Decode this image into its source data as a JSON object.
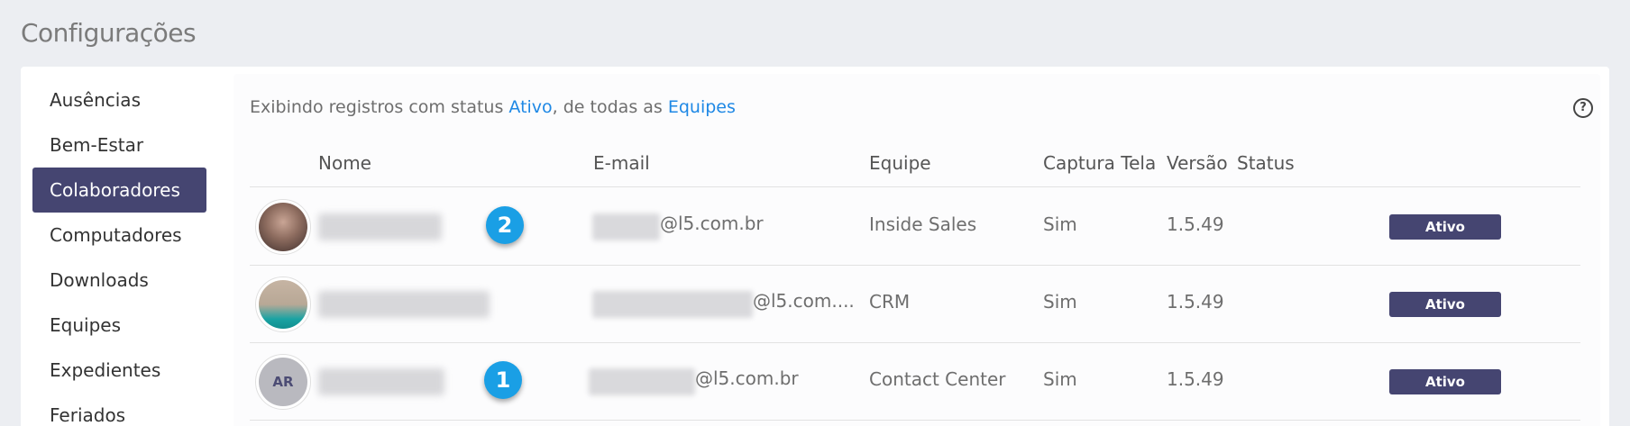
{
  "page": {
    "title": "Configurações"
  },
  "sidebar": {
    "items": [
      {
        "label": "Ausências"
      },
      {
        "label": "Bem-Estar"
      },
      {
        "label": "Colaboradores",
        "active": true
      },
      {
        "label": "Computadores"
      },
      {
        "label": "Downloads"
      },
      {
        "label": "Equipes"
      },
      {
        "label": "Expedientes"
      },
      {
        "label": "Feriados"
      }
    ]
  },
  "filter": {
    "prefix": "Exibindo registros com status ",
    "status_link": "Ativo",
    "middle": ", de todas as ",
    "team_link": "Equipes"
  },
  "help_icon": "?",
  "table": {
    "headers": {
      "name": "Nome",
      "email": "E-mail",
      "team": "Equipe",
      "capture": "Captura Tela",
      "version": "Versão",
      "status": "Status"
    },
    "rows": [
      {
        "avatar": "photo",
        "email_suffix": "@l5.com.br",
        "team": "Inside Sales",
        "capture": "Sim",
        "version": "1.5.49",
        "status": "Ativo",
        "step": "2"
      },
      {
        "avatar": "photo",
        "email_suffix": "@l5.com....",
        "team": "CRM",
        "capture": "Sim",
        "version": "1.5.49",
        "status": "Ativo"
      },
      {
        "avatar_initials": "AR",
        "email_suffix": "@l5.com.br",
        "team": "Contact Center",
        "capture": "Sim",
        "version": "1.5.49",
        "status": "Ativo",
        "step": "1"
      }
    ]
  },
  "colors": {
    "accent": "#454571",
    "link": "#1e88e5",
    "step_badge": "#1a9fe5"
  }
}
